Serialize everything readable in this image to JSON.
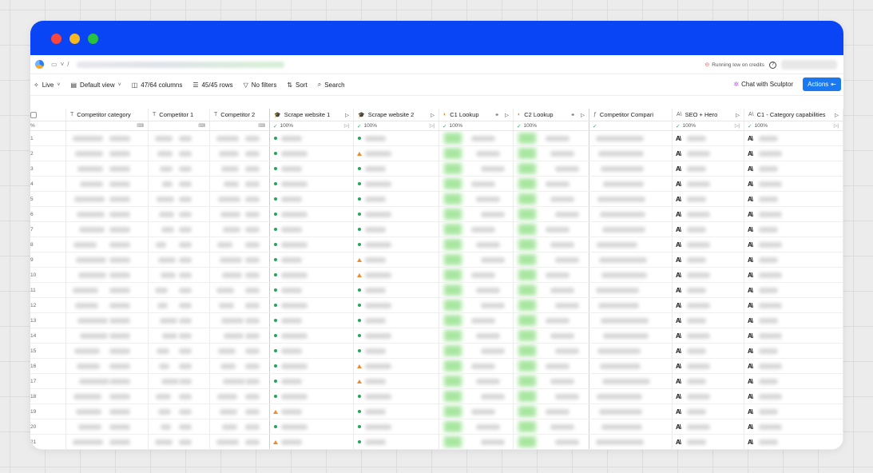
{
  "window": {
    "controls": [
      "close",
      "minimize",
      "maximize"
    ]
  },
  "navbar": {
    "logo_icon": "app-logo-icon",
    "folder_icon": "folder-icon",
    "chevron": "˅",
    "separator": "/",
    "credit_warning": "Running low on credits",
    "help_icon": "help-circle-icon"
  },
  "toolbar": {
    "live": "Live",
    "view": "Default view",
    "columns": "47/64 columns",
    "rows": "45/45 rows",
    "filters": "No filters",
    "sort": "Sort",
    "search": "Search",
    "chat": "Chat with Sculptor",
    "actions": "Actions"
  },
  "columns": [
    {
      "key": "competitor_category",
      "label": "Competitor category",
      "type": "text",
      "stat": "",
      "kind": "text"
    },
    {
      "key": "competitor_1",
      "label": "Competitor 1",
      "type": "text",
      "stat": "",
      "kind": "text"
    },
    {
      "key": "competitor_2",
      "label": "Competitor 2",
      "type": "text",
      "stat": "",
      "kind": "text"
    },
    {
      "key": "scrape_1",
      "label": "Scrape website 1",
      "type": "scrape",
      "stat": "100%",
      "kind": "status"
    },
    {
      "key": "scrape_2",
      "label": "Scrape website 2",
      "type": "scrape",
      "stat": "100%",
      "kind": "status"
    },
    {
      "key": "c1_lookup",
      "label": "C1 Lookup",
      "type": "lookup",
      "stat": "100%",
      "kind": "lookup"
    },
    {
      "key": "c2_lookup",
      "label": "C2 Lookup",
      "type": "lookup",
      "stat": "100%",
      "kind": "lookup"
    },
    {
      "key": "competitor_compari",
      "label": "Competitor Compari",
      "type": "formula",
      "stat": "",
      "kind": "text"
    },
    {
      "key": "seo_hero",
      "label": "SEO + Hero",
      "type": "ai",
      "stat": "100%",
      "kind": "ai"
    },
    {
      "key": "c1_category",
      "label": "C1 - Category capabilities",
      "type": "ai",
      "stat": "100%",
      "kind": "ai"
    }
  ],
  "row_numbers": [
    "1",
    "2",
    "3",
    "4",
    "5",
    "6",
    "7",
    "8",
    "9",
    "10",
    "11",
    "12",
    "13",
    "14",
    "15",
    "16",
    "17",
    "18",
    "19",
    "20",
    "21"
  ],
  "scrape1_status": [
    "ok",
    "ok",
    "ok",
    "ok",
    "ok",
    "ok",
    "ok",
    "ok",
    "ok",
    "ok",
    "ok",
    "ok",
    "ok",
    "ok",
    "ok",
    "ok",
    "ok",
    "ok",
    "warn",
    "ok",
    "warn"
  ],
  "scrape2_status": [
    "ok",
    "warn",
    "ok",
    "ok",
    "ok",
    "ok",
    "ok",
    "ok",
    "warn",
    "warn",
    "ok",
    "ok",
    "ok",
    "ok",
    "ok",
    "warn",
    "warn",
    "ok",
    "ok",
    "ok",
    "ok"
  ],
  "colors": {
    "accent": "#0a45f5",
    "button": "#1a78f0",
    "ok": "#1fa85a",
    "warn": "#f08a2a"
  }
}
